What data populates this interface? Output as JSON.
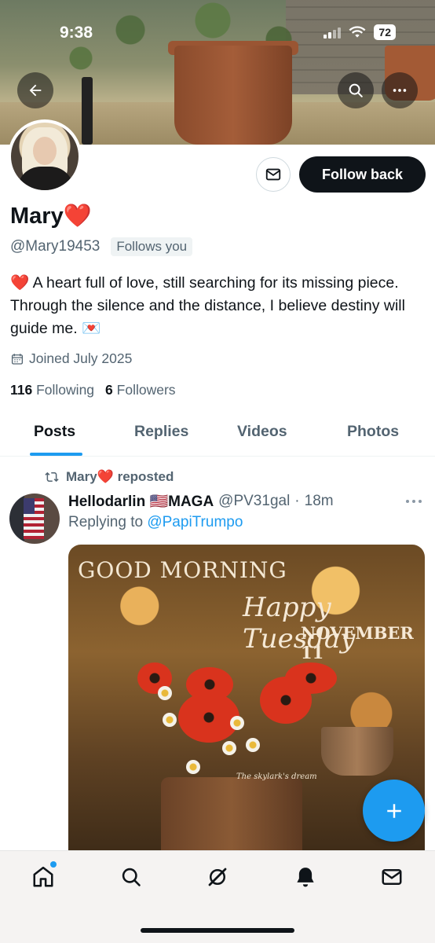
{
  "status_bar": {
    "time": "9:38",
    "battery": "72"
  },
  "profile": {
    "display_name": "Mary❤️",
    "handle": "@Mary19453",
    "follows_you": "Follows you",
    "bio": "❤️ A heart full of love, still searching for its missing piece. Through the silence and the distance, I believe destiny will guide me. 💌",
    "joined": "Joined July 2025",
    "following_count": "116",
    "following_label": "Following",
    "followers_count": "6",
    "followers_label": "Followers",
    "follow_button": "Follow back"
  },
  "tabs": [
    {
      "label": "Posts",
      "active": true
    },
    {
      "label": "Replies",
      "active": false
    },
    {
      "label": "Videos",
      "active": false
    },
    {
      "label": "Photos",
      "active": false
    }
  ],
  "post": {
    "repost_label": "Mary❤️ reposted",
    "author_name": "Hellodarlin 🇺🇸MAGA",
    "author_handle": "@PV31gal",
    "separator": "·",
    "time": "18m",
    "replying_prefix": "Replying to",
    "replying_to": "@PapiTrumpo",
    "image_text": {
      "greeting": "GOOD MORNING",
      "day": "Happy Tuesday",
      "date": "NOVEMBER 11",
      "watermark": "The skylark's dream"
    }
  },
  "colors": {
    "accent": "#1d9bf0",
    "text": "#0f1419",
    "muted": "#536471"
  },
  "icons": [
    "back-arrow-icon",
    "search-icon",
    "more-icon",
    "mail-icon",
    "calendar-icon",
    "repost-icon",
    "plus-icon",
    "home-icon",
    "explore-icon",
    "grok-icon",
    "notifications-icon",
    "messages-icon"
  ]
}
